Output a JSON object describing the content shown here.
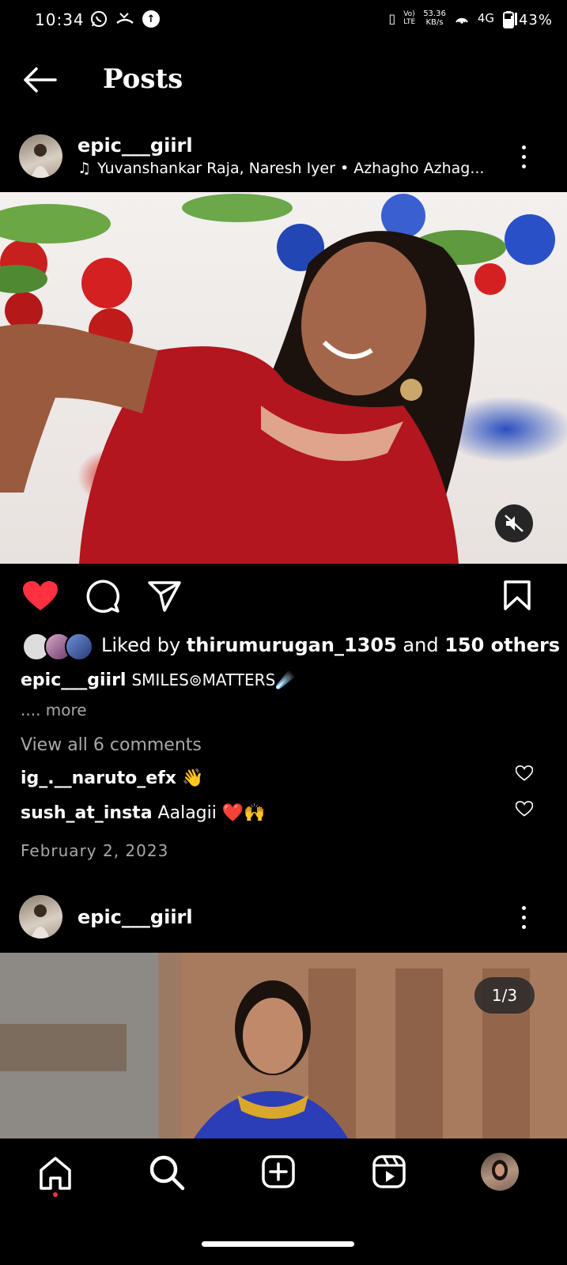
{
  "status_bar": {
    "time": "10:34",
    "net_speed_value": "53.36",
    "net_speed_unit": "KB/s",
    "volte_top": "Vo)",
    "volte_bottom": "LTE",
    "network": "4G",
    "battery": "43%"
  },
  "header": {
    "title": "Posts"
  },
  "post1": {
    "username": "epic___giirl",
    "music": "Yuvanshankar Raja, Naresh Iyer • Azhagho Azhag...",
    "liked_by_prefix": "Liked by ",
    "liked_by_user": "thirumurugan_1305",
    "liked_by_middle": " and ",
    "liked_by_count": "150 others",
    "caption_user": "epic___giirl",
    "caption_text": "SMILES⊚MATTERS☄️",
    "more": ".... more",
    "view_comments": "View all 6 comments",
    "comments": [
      {
        "user": "ig_.__naruto_efx",
        "text": "👋"
      },
      {
        "user": "sush_at_insta",
        "text": "Aalagii ❤️🙌"
      }
    ],
    "date": "February 2, 2023"
  },
  "post2": {
    "username": "epic___giirl",
    "counter": "1/3"
  },
  "colors": {
    "like": "#ff3040",
    "background": "#000000",
    "secondary_text": "#a8a8a8"
  },
  "nav": {
    "items": [
      "home-icon",
      "search-icon",
      "create-icon",
      "reels-icon",
      "profile-avatar"
    ]
  }
}
